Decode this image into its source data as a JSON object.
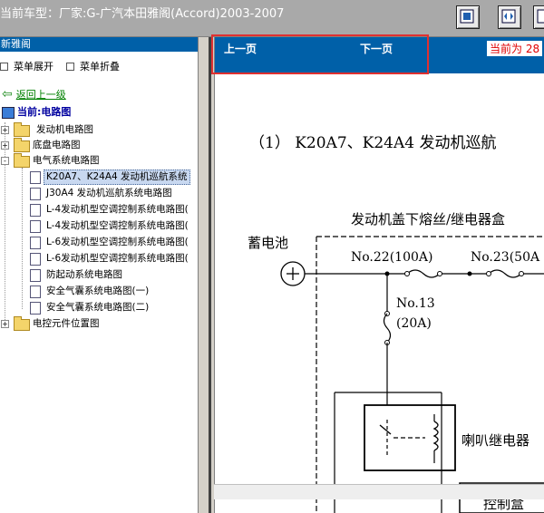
{
  "header": {
    "car_title": "当前车型：厂家:G-广汽本田雅阁(Accord)2003-2007",
    "buttons": [
      {
        "icon": "single-pane-icon"
      },
      {
        "icon": "split-view-icon"
      },
      {
        "icon": "fullscreen-icon"
      }
    ]
  },
  "left": {
    "header_label": "新雅阁",
    "expand_label": "菜单展开",
    "collapse_label": "菜单折叠",
    "back_label": "返回上一级",
    "current_label": "当前:电路图",
    "tree": [
      {
        "label": "发动机电路图",
        "type": "folder",
        "expander": "+"
      },
      {
        "label": "底盘电路图",
        "type": "folder",
        "expander": "+"
      },
      {
        "label": "电气系统电路图",
        "type": "folder",
        "expander": "-"
      },
      {
        "label": "K20A7、K24A4 发动机巡航系统",
        "type": "doc",
        "selected": true
      },
      {
        "label": "J30A4 发动机巡航系统电路图",
        "type": "doc"
      },
      {
        "label": "L-4发动机型空调控制系统电路图(",
        "type": "doc"
      },
      {
        "label": "L-4发动机型空调控制系统电路图(",
        "type": "doc"
      },
      {
        "label": "L-6发动机型空调控制系统电路图(",
        "type": "doc"
      },
      {
        "label": "L-6发动机型空调控制系统电路图(",
        "type": "doc"
      },
      {
        "label": "防起动系统电路图",
        "type": "doc"
      },
      {
        "label": "安全气囊系统电路图(一)",
        "type": "doc"
      },
      {
        "label": "安全气囊系统电路图(二)",
        "type": "doc"
      },
      {
        "label": "电控元件位置图",
        "type": "folder",
        "expander": "+"
      }
    ]
  },
  "right": {
    "prev_label": "上一页",
    "next_label": "下一页",
    "page_status": "当前为 28",
    "doc_title": "（1） K20A7、K24A4 发动机巡航",
    "diagram": {
      "fuse_box_label": "发动机盖下熔丝/继电器盒",
      "battery_label": "蓄电池",
      "fuse1_label": "No.22(100A)",
      "fuse2_label": "No.23(50A",
      "fuse3_label": "No.13",
      "fuse3_rating": "(20A)",
      "relay_label": "喇叭继电器",
      "control_box_label": "控制盒"
    }
  }
}
